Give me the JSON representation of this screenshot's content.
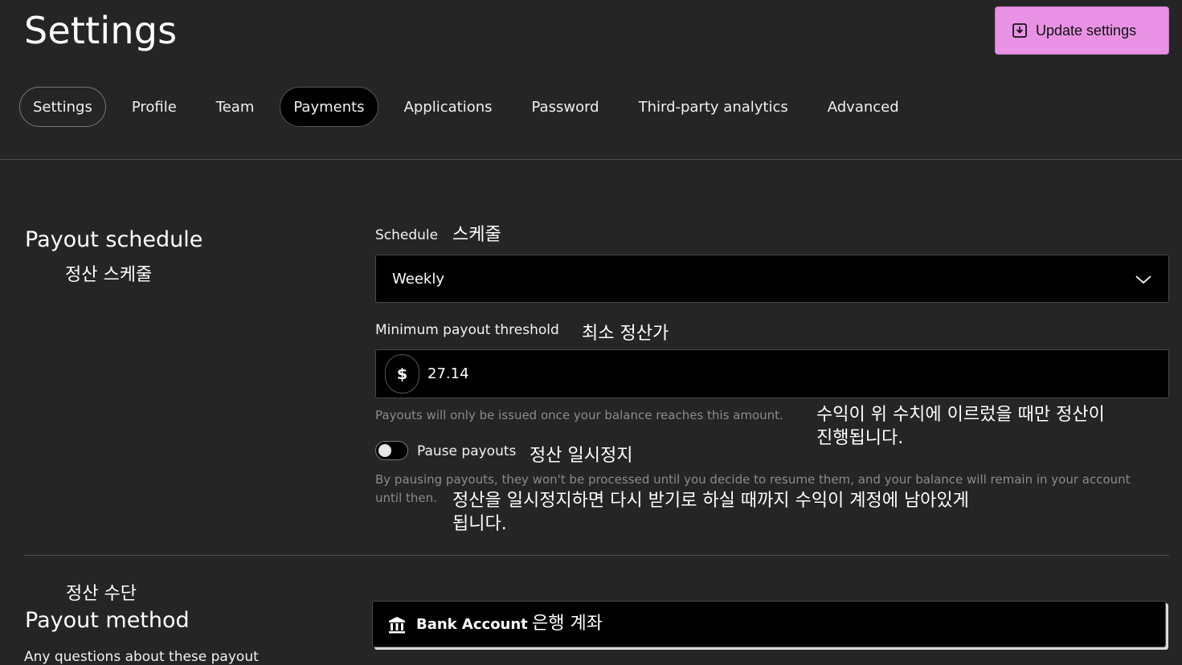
{
  "page_title": "Settings",
  "header": {
    "update_button_label": "Update settings"
  },
  "tabs": [
    {
      "label": "Settings"
    },
    {
      "label": "Profile"
    },
    {
      "label": "Team"
    },
    {
      "label": "Payments"
    },
    {
      "label": "Applications"
    },
    {
      "label": "Password"
    },
    {
      "label": "Third-party analytics"
    },
    {
      "label": "Advanced"
    }
  ],
  "active_tab": "Payments",
  "payout_schedule": {
    "title": "Payout schedule",
    "title_ko": "정산 스케줄",
    "schedule_label": "Schedule",
    "schedule_label_ko": "스케줄",
    "schedule_value": "Weekly",
    "threshold_label": "Minimum payout threshold",
    "threshold_label_ko": "최소 정산가",
    "currency_symbol": "$",
    "threshold_value": "27.14",
    "threshold_help": "Payouts will only be issued once your balance reaches this amount.",
    "threshold_help_ko_line1": "수익이 위 수치에 이르렀을 때만 정산이",
    "threshold_help_ko_line2": "진행됩니다.",
    "pause_label": "Pause payouts",
    "pause_label_ko": "정산 일시정지",
    "pause_enabled": false,
    "pause_help_line1": "By pausing payouts, they won't be processed until you decide to resume them, and your balance will remain in your account",
    "pause_help_line2": "until then.",
    "pause_help_ko_line1": "정산을 일시정지하면 다시 받기로 하실 때까지 수익이 계정에 남아있게",
    "pause_help_ko_line2": "됩니다."
  },
  "payout_method": {
    "title": "Payout method",
    "title_ko": "정산 수단",
    "description": "Any questions about these payout",
    "bank_label": "Bank Account",
    "bank_label_ko": "은행 계좌"
  },
  "colors": {
    "background": "#252525",
    "accent_button": "#e992e5",
    "input_background": "#000000"
  },
  "icons": {
    "update_button": "download-box-icon",
    "select": "chevron-down-icon",
    "bank": "bank-icon"
  }
}
